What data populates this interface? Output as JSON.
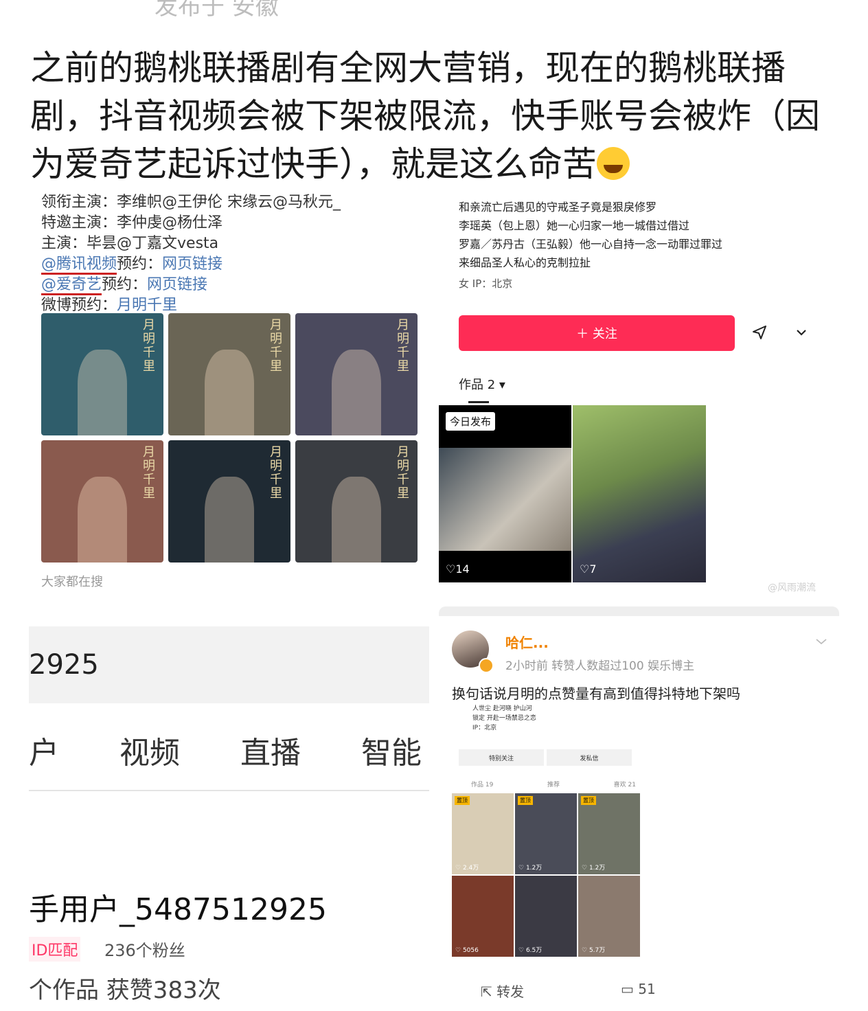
{
  "header": {
    "location": "发布于 安徽"
  },
  "post": {
    "text": "之前的鹅桃联播剧有全网大营销，现在的鹅桃联播剧，抖音视频会被下架被限流，快手账号会被炸（因为爱奇艺起诉过快手），就是这么命苦"
  },
  "weibo_card": {
    "rows": [
      {
        "label": "领衔主演：",
        "value": "李维帜@王伊伦 宋缘云@马秋元_"
      },
      {
        "label": "特邀主演：",
        "value": "李仲虔@杨仕泽"
      },
      {
        "label": "主演：",
        "value": "毕昙@丁嘉文vesta"
      }
    ],
    "preorder": [
      {
        "platform": "@腾讯视频",
        "suffix": "预约：",
        "link": "网页链接"
      },
      {
        "platform": "@爱奇艺",
        "suffix": "预约：",
        "link": "网页链接"
      },
      {
        "platform": "微博预约：",
        "suffix": "",
        "link": "月明千里"
      }
    ],
    "posters": [
      {
        "title": "月明千里",
        "bg": "#2f5d6b"
      },
      {
        "title": "月明千里",
        "bg": "#6a6555"
      },
      {
        "title": "月明千里",
        "bg": "#4b4a5e"
      },
      {
        "title": "月明千里",
        "bg": "#8a5a4e"
      },
      {
        "title": "月明千里",
        "bg": "#1f2a33"
      },
      {
        "title": "月明千里",
        "bg": "#3a3d42"
      }
    ],
    "search_hint": "大家都在搜"
  },
  "douyin": {
    "bio_lines": [
      "和亲流亡后遇见的守戒圣子竟是狠戾修罗",
      "李瑶英（包上恩）她一心归家一地一城借过借过",
      "罗嘉／苏丹古（王弘毅）他一心自持一念一动罪过罪过",
      "来细品圣人私心的克制拉扯"
    ],
    "meta": "女    IP：北京",
    "follow_label": "＋ 关注",
    "works_tab": "作品 2",
    "video1": {
      "badge": "今日发布",
      "likes": "14"
    },
    "video2": {
      "likes": "7"
    },
    "watermark": "@风雨潮流"
  },
  "kuaishou": {
    "id_number": "2925",
    "tabs": [
      "户",
      "视频",
      "直播",
      "智能"
    ],
    "username": "手用户_5487512925",
    "id_chip": "ID匹配",
    "fans": "236个粉丝",
    "stats": "个作品 获赞383次"
  },
  "repost": {
    "username": "哈仁...",
    "meta": "2小时前  转赞人数超过100  娱乐博主",
    "text": "换句话说月明的点赞量有高到值得抖特地下架吗",
    "mini": {
      "bio": [
        "人世尘 赴河晓 护山河",
        "锁定 开赴一场禁忌之恋",
        "IP：北京"
      ],
      "buttons": [
        "特别关注",
        "发私信"
      ],
      "tabs": [
        "作品 19",
        "推荐",
        "喜欢 21"
      ],
      "cells": [
        {
          "tag": "置顶",
          "likes": "2.4万",
          "bg": "#d9cdb5"
        },
        {
          "tag": "置顶",
          "likes": "1.2万",
          "bg": "#4a4c58"
        },
        {
          "tag": "置顶",
          "likes": "1.2万",
          "bg": "#6f7366"
        },
        {
          "tag": "",
          "likes": "5056",
          "bg": "#7a3a2a"
        },
        {
          "tag": "",
          "likes": "6.5万",
          "bg": "#3b3a44"
        },
        {
          "tag": "",
          "likes": "5.7万",
          "bg": "#8b7a6e"
        }
      ]
    },
    "repost_label": "转发",
    "comments": "51"
  }
}
